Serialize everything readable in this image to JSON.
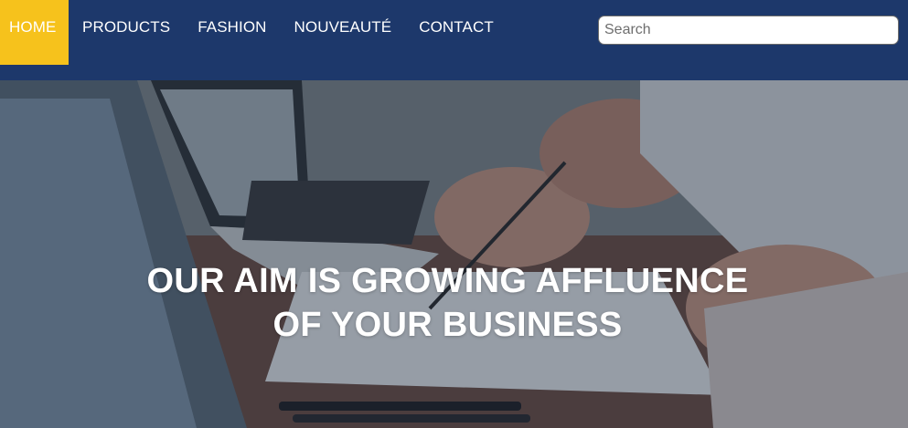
{
  "nav": {
    "items": [
      {
        "label": "HOME",
        "active": true
      },
      {
        "label": "PRODUCTS",
        "active": false
      },
      {
        "label": "FASHION",
        "active": false
      },
      {
        "label": "NOUVEAUTÉ",
        "active": false
      },
      {
        "label": "CONTACT",
        "active": false
      }
    ],
    "search": {
      "placeholder": "Search",
      "value": ""
    }
  },
  "hero": {
    "headline_line1": "OUR AIM IS GROWING AFFLUENCE",
    "headline_line2": "OF YOUR BUSINESS"
  },
  "colors": {
    "nav_background": "#1d386b",
    "active_tab": "#f6c21c",
    "text": "#ffffff"
  }
}
